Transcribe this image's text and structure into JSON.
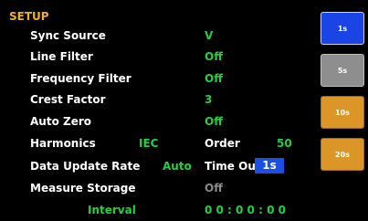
{
  "header": {
    "title": "SETUP"
  },
  "rows": {
    "sync_source": {
      "label": "Sync Source",
      "value": "V"
    },
    "line_filter": {
      "label": "Line Filter",
      "value": "Off"
    },
    "frequency_filter": {
      "label": "Frequency Filter",
      "value": "Off"
    },
    "crest_factor": {
      "label": "Crest Factor",
      "value": "3"
    },
    "auto_zero": {
      "label": "Auto Zero",
      "value": "Off"
    },
    "harmonics": {
      "label": "Harmonics",
      "value": "IEC",
      "order_label": "Order",
      "order_value": "50"
    },
    "data_update": {
      "label": "Data Update Rate",
      "value": "Auto",
      "timeout_label": "Time Out",
      "timeout_value": "1s"
    },
    "measure_storage": {
      "label": "Measure Storage",
      "value": "Off"
    },
    "interval": {
      "label": "Interval",
      "value": "0 0 : 0 0 : 0 0"
    }
  },
  "sidebar": {
    "buttons": [
      {
        "label": "1s",
        "state": "active"
      },
      {
        "label": "5s",
        "state": "disabled"
      },
      {
        "label": "10s",
        "state": "normal"
      },
      {
        "label": "20s",
        "state": "normal"
      }
    ]
  },
  "colors": {
    "title": "#f0b020",
    "label": "#ffffff",
    "value": "#22d040",
    "selected": "#1c4ee0",
    "button_normal": "#dc9628",
    "button_disabled": "#8e8e8e",
    "button_active": "#1a44e6"
  }
}
